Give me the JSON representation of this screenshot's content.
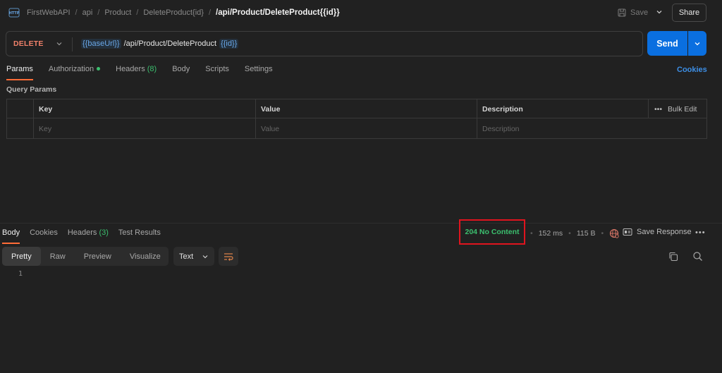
{
  "breadcrumb": {
    "items": [
      "FirstWebAPI",
      "api",
      "Product",
      "DeleteProduct{id}"
    ],
    "current": "/api/Product/DeleteProduct{{id}}"
  },
  "toolbar": {
    "save_label": "Save",
    "share_label": "Share"
  },
  "request": {
    "method": "DELETE",
    "url_var_base": "{{baseUrl}}",
    "url_path": "/api/Product/DeleteProduct",
    "url_var_id": "{{id}}",
    "send_label": "Send"
  },
  "request_tabs": [
    {
      "label": "Params"
    },
    {
      "label": "Authorization"
    },
    {
      "label": "Headers",
      "count": "(8)"
    },
    {
      "label": "Body"
    },
    {
      "label": "Scripts"
    },
    {
      "label": "Settings"
    }
  ],
  "cookies_label": "Cookies",
  "query_params": {
    "title": "Query Params",
    "headers": {
      "key": "Key",
      "value": "Value",
      "description": "Description"
    },
    "placeholders": {
      "key": "Key",
      "value": "Value",
      "description": "Description"
    },
    "bulk_edit_label": "Bulk Edit"
  },
  "response": {
    "tabs": [
      {
        "label": "Body"
      },
      {
        "label": "Cookies"
      },
      {
        "label": "Headers",
        "count": "(3)"
      },
      {
        "label": "Test Results"
      }
    ],
    "status": "204 No Content",
    "time": "152 ms",
    "size": "115 B",
    "save_response_label": "Save Response",
    "format_options": [
      "Pretty",
      "Raw",
      "Preview",
      "Visualize"
    ],
    "format_type": "Text",
    "line_number": "1"
  },
  "colors": {
    "accent_tab": "#ff6c37",
    "send": "#0a6fe0",
    "method": "#f0816a",
    "status_ok": "#3bbf6e",
    "highlight_box": "#e0141e"
  }
}
